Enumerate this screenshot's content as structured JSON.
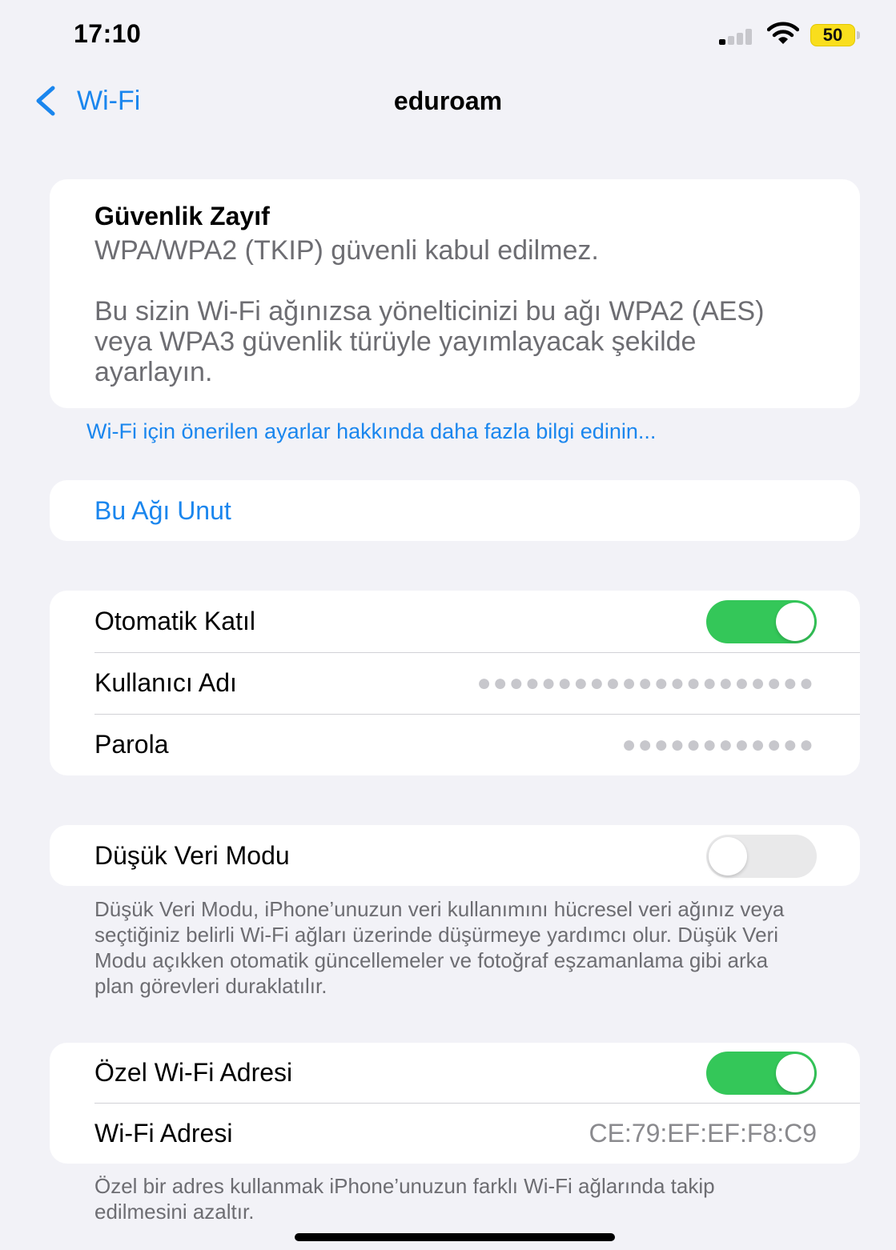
{
  "status_bar": {
    "time": "17:10",
    "battery": "50"
  },
  "nav": {
    "back_label": "Wi-Fi",
    "title": "eduroam"
  },
  "security": {
    "title": "Güvenlik Zayıf",
    "body_line1": "WPA/WPA2 (TKIP) güvenli kabul edilmez.",
    "body_line2": "Bu sizin Wi-Fi ağınızsa yönelticinizi bu ağı WPA2 (AES) veya WPA3 güvenlik türüyle yayımlayacak şekilde ayarlayın."
  },
  "learn_more_link": "Wi-Fi için önerilen ayarlar hakkında daha fazla bilgi edinin...",
  "forget_network": "Bu Ağı Unut",
  "settings": {
    "auto_join": {
      "label": "Otomatik Katıl",
      "enabled": true
    },
    "username": {
      "label": "Kullanıcı Adı",
      "value": "●●●●●●●●●●●●●●●●●●●●●"
    },
    "password": {
      "label": "Parola",
      "value": "●●●●●●●●●●●●"
    }
  },
  "low_data_mode": {
    "label": "Düşük Veri Modu",
    "enabled": false,
    "footnote": "Düşük Veri Modu, iPhone’unuzun veri kullanımını hücresel veri ağınız veya seçtiğiniz belirli Wi-Fi ağları üzerinde düşürmeye yardımcı olur. Düşük Veri Modu açıkken otomatik güncellemeler ve fotoğraf eşzamanlama gibi arka plan görevleri duraklatılır."
  },
  "private_address": {
    "label": "Özel Wi-Fi Adresi",
    "enabled": true,
    "address_label": "Wi-Fi Adresi",
    "address_value": "CE:79:EF:EF:F8:C9",
    "footnote": "Özel bir adres kullanmak iPhone’unuzun farklı Wi-Fi ağlarında takip edilmesini azaltır."
  },
  "colors": {
    "accent": "#1a86ee",
    "toggle_on": "#34c759",
    "background": "#f2f2f7"
  },
  "icons": [
    "signal-icon",
    "wifi-icon",
    "battery-icon",
    "chevron-left-icon"
  ]
}
